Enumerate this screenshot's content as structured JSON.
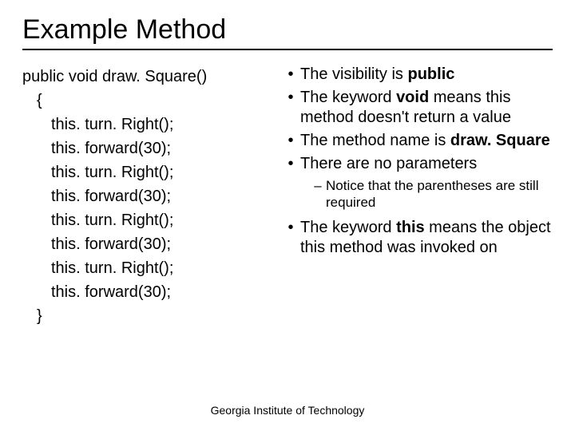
{
  "title": "Example Method",
  "code": {
    "line1": "public void draw. Square()",
    "line2": "{",
    "line3": "this. turn. Right();",
    "line4": "this. forward(30);",
    "line5": "this. turn. Right();",
    "line6": "this. forward(30);",
    "line7": "this. turn. Right();",
    "line8": "this. forward(30);",
    "line9": "this. turn. Right();",
    "line10": "this. forward(30);",
    "line11": "}"
  },
  "bullets": {
    "b1_pre": "The visibility is ",
    "b1_bold": "public",
    "b2_pre": "The keyword ",
    "b2_bold": "void",
    "b2_post": " means this method doesn't return a value",
    "b3_pre": "The method name is ",
    "b3_bold": "draw. Square",
    "b4": "There are no parameters",
    "sub1": "Notice that the parentheses are still required",
    "b5_pre": "The keyword ",
    "b5_bold": "this",
    "b5_post": " means the object this method was invoked on"
  },
  "footer": "Georgia Institute of Technology"
}
